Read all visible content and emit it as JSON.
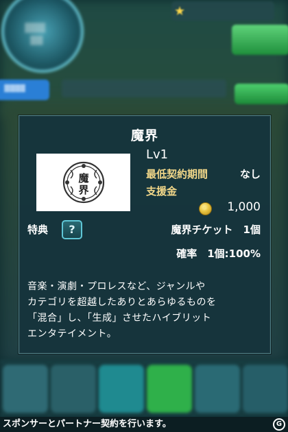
{
  "modal": {
    "title": "魔界",
    "level": "Lv1",
    "min_period_label": "最低契約期間",
    "min_period_value": "なし",
    "support_label": "支援金",
    "support_value": "1,000",
    "perk_label": "特典",
    "help_symbol": "?",
    "ticket_text": "魔界チケット　1個",
    "rate_text": "確率　1個:100%",
    "description_lines": [
      "音楽・演劇・プロレスなど、ジャンルや",
      "カテゴリを超越したありとあらゆるものを",
      "「混合」し、「生成」させたハイブリット",
      "エンタテイメント。"
    ],
    "emblem_text": "魔界"
  },
  "footer": {
    "text": "スポンサーとパートナー契約を行います。"
  },
  "colors": {
    "modal_bg": "#16343c",
    "label_gold": "#f4d98a",
    "accent_cyan": "#5fc6d6"
  },
  "icons": {
    "coin": "gold-coin-icon",
    "help": "question-mark-icon",
    "logo": "site-logo-icon"
  }
}
